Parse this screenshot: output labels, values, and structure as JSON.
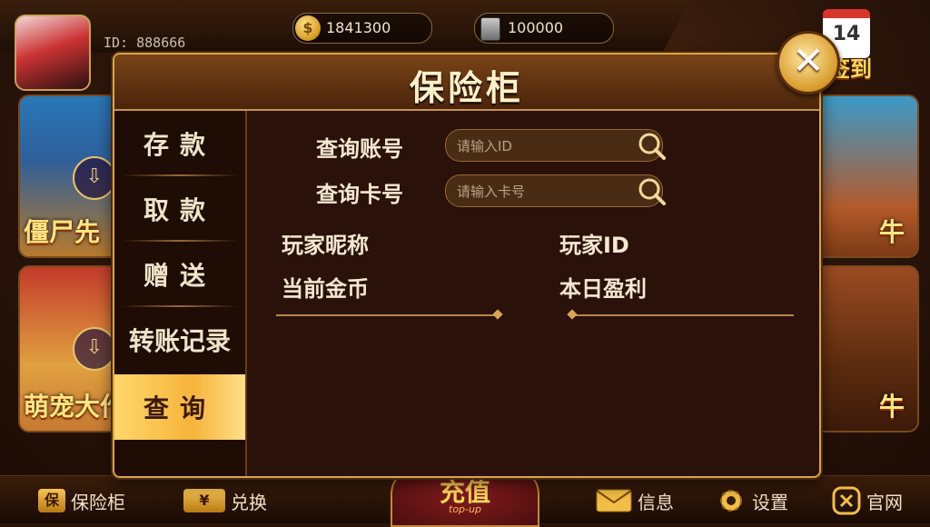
{
  "player": {
    "id_text": "ID: 888666"
  },
  "currency": {
    "coins": "1841300",
    "cards": "100000"
  },
  "checkin": {
    "day": "14",
    "label": "签到"
  },
  "background_games": [
    {
      "label": "僵尸先"
    },
    {
      "label": "萌宠大作"
    },
    {
      "label": "牛"
    },
    {
      "label": "牛"
    }
  ],
  "modal": {
    "title": "保险柜",
    "close_glyph": "✕",
    "menu": [
      {
        "label": "存款",
        "active": false
      },
      {
        "label": "取款",
        "active": false
      },
      {
        "label": "赠送",
        "active": false
      },
      {
        "label": "转账记录",
        "active": false
      },
      {
        "label": "查询",
        "active": true
      }
    ],
    "query": {
      "account_label": "查询账号",
      "account_placeholder": "请输入ID",
      "card_label": "查询卡号",
      "card_placeholder": "请输入卡号",
      "nickname_label": "玩家昵称",
      "player_id_label": "玩家ID",
      "current_coins_label": "当前金币",
      "today_profit_label": "本日盈利"
    }
  },
  "bottom_nav": {
    "safe": "保险柜",
    "exchange": "兑换",
    "topup": "充值",
    "topup_sub": "top-up",
    "messages": "信息",
    "settings": "设置",
    "website": "官网",
    "safe_icon_char": "保",
    "exchange_icon_char": "¥"
  },
  "colors": {
    "accent_gold": "#d9a64a",
    "active_tab": "#f6b43a",
    "panel_bg": "#2a1109"
  }
}
